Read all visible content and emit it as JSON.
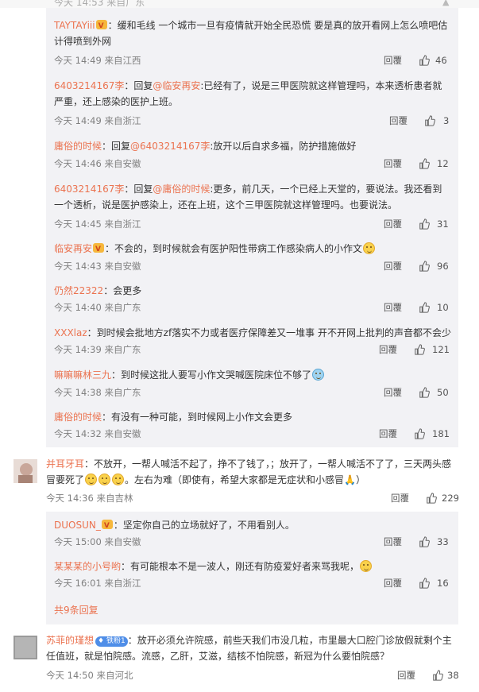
{
  "top_ghost": "今天 14:53 来自广东",
  "replies": [
    {
      "user": "TAYTAYiii",
      "badge": true,
      "text": "：缓和毛线 一个城市一旦有疫情就开始全民恐慌 要是真的放开看网上怎么喷吧估计得喷到外网",
      "time": "今天 14:49 来自江西",
      "reply": "回覆",
      "likes": "46"
    },
    {
      "user": "6403214167李",
      "text": "：回复",
      "mention": "@临安再安",
      "text2": ":已经有了，说是三甲医院就这样管理吗，本来透析患者就严重，还上感染的医护上班。",
      "time": "今天 14:49 来自浙江",
      "reply": "回覆",
      "likes": "3"
    },
    {
      "user": "庸俗的时候",
      "text": "：回复",
      "mention": "@6403214167李",
      "text2": ":放开以后自求多福，防护措施做好",
      "time": "今天 14:46 来自安徽",
      "reply": "回覆",
      "likes": "12"
    },
    {
      "user": "6403214167李",
      "text": "：回复",
      "mention": "@庸俗的时候",
      "text2": ":更多，前几天，一个已经上天堂的，要说法。我还看到一个透析，说是医护感染上，还在上班，这个三甲医院就这样管理吗。也要说法。",
      "time": "今天 14:45 来自浙江",
      "reply": "回覆",
      "likes": "31"
    },
    {
      "user": "临安再安",
      "badge": true,
      "text": "：不会的，到时候就会有医护阳性带病工作感染病人的小作文",
      "time": "今天 14:43 来自安徽",
      "reply": "回覆",
      "likes": "96"
    },
    {
      "user": "仍然22322",
      "text": "：会更多",
      "time": "今天 14:40 来自广东",
      "reply": "回覆",
      "likes": "10"
    },
    {
      "user": "XXXlaz",
      "text": "：到时候会批地方zf落实不力或者医疗保障差又一堆事 开不开网上批判的声音都不会少",
      "time": "今天 14:39 来自广东",
      "reply": "回覆",
      "likes": "121"
    },
    {
      "user": "嘛嘛嘛林三九",
      "text": "：到时候这批人要写小作文哭喊医院床位不够了",
      "time": "今天 14:38 来自广东",
      "reply": "回覆",
      "likes": "50"
    },
    {
      "user": "庸俗的时候",
      "text": "：有没有一种可能，到时候网上小作文会更多",
      "time": "今天 14:32 来自安徽",
      "reply": "回覆",
      "likes": "181"
    }
  ],
  "comment1": {
    "user": "并耳牙耳",
    "text": "：不放开，一帮人喊活不起了，挣不了钱了，；放开了，一帮人喊活不了了，三天两头感冒要死了",
    "text2": "。左右为难（即使有，希望大家都是无症状和小感冒",
    "text3": "）",
    "time": "今天 14:36 来自吉林",
    "reply": "回覆",
    "likes": "229"
  },
  "sub_replies": [
    {
      "user": "DUOSUN_",
      "badge": true,
      "text": "：坚定你自己的立场就好了，不用看别人。",
      "time": "今天 15:00 来自安徽",
      "reply": "回覆",
      "likes": "33"
    },
    {
      "user": "某某某的小号哟",
      "text": "：有可能根本不是一波人，刚还有防疫爱好者来骂我呢，",
      "time": "今天 16:01 来自浙江",
      "reply": "回覆",
      "likes": "16"
    }
  ],
  "more_replies": "共9条回复",
  "comment2": {
    "user": "苏菲的瑾想",
    "vip": "铁粉1",
    "text": "：放开必须允许院感，前些天我们市没几粒，市里最大口腔门诊放假就剩个主任值班，就是怕院感。流感，乙肝，艾滋，结核不怕院感，新冠为什么要怕院感？",
    "time": "今天 14:50 来自河北",
    "reply": "回覆",
    "likes": "38"
  },
  "icons": {
    "like": "thumbs-up-icon",
    "badge": "verified-badge-icon",
    "emoji": "emoji-icon"
  }
}
